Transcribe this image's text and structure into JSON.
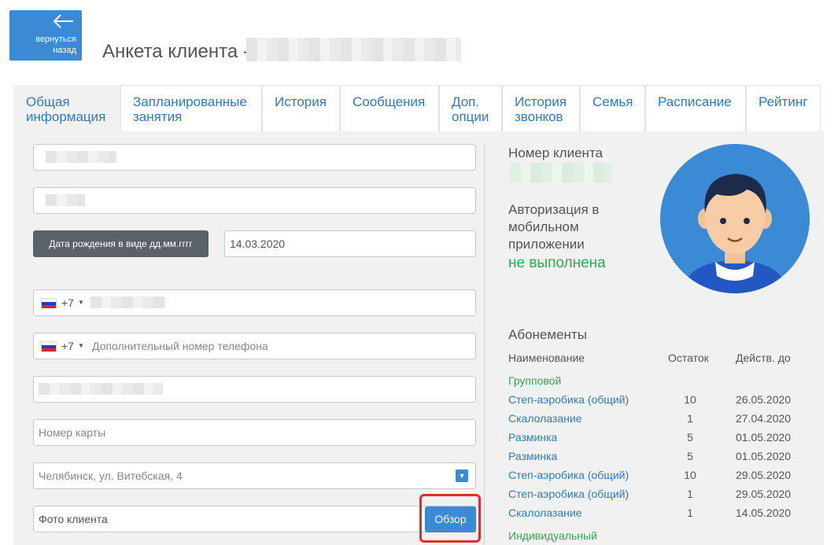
{
  "back_button": {
    "label": "вернуться назад",
    "icon": "arrow-left-icon"
  },
  "page": {
    "title": "Анкета клиента -"
  },
  "tabs": [
    {
      "label": "Общая информация",
      "active": true
    },
    {
      "label": "Запланированные занятия"
    },
    {
      "label": "История"
    },
    {
      "label": "Сообщения"
    },
    {
      "label": "Доп. опции"
    },
    {
      "label": "История звонков"
    },
    {
      "label": "Семья"
    },
    {
      "label": "Расписание"
    },
    {
      "label": "Рейтинг"
    }
  ],
  "form": {
    "dob_label": "Дата рождения в виде дд.мм.гггг",
    "dob_value": "14.03.2020",
    "phone_code": "+7",
    "extra_phone_placeholder": "Дополнительный номер телефона",
    "card_placeholder": "Номер карты",
    "address_value": "Челябинск, ул. Витебская, 4",
    "photo_placeholder": "Фото клиента",
    "browse_label": "Обзор"
  },
  "client": {
    "number_label": "Номер клиента",
    "auth_label": "Авторизация в мобильном приложении",
    "auth_status": "не выполнена",
    "auth_status_color": "#2eab4f"
  },
  "subscriptions": {
    "title": "Абонементы",
    "headers": {
      "name": "Наименование",
      "remain": "Остаток",
      "valid": "Действ. до"
    },
    "group1": "Групповой",
    "rows": [
      {
        "name": "Степ-аэробика (общий)",
        "remain": "10",
        "valid": "26.05.2020"
      },
      {
        "name": "Скалолазание",
        "remain": "1",
        "valid": "27.04.2020"
      },
      {
        "name": "Разминка",
        "remain": "5",
        "valid": "01.05.2020"
      },
      {
        "name": "Разминка",
        "remain": "5",
        "valid": "01.05.2020"
      },
      {
        "name": "Степ-аэробика (общий)",
        "remain": "10",
        "valid": "29.05.2020"
      },
      {
        "name": "Степ-аэробика (общий)",
        "remain": "1",
        "valid": "29.05.2020"
      },
      {
        "name": "Скалолазание",
        "remain": "1",
        "valid": "14.05.2020"
      }
    ],
    "group2": "Индивидуальный"
  },
  "colors": {
    "accent": "#3a8ad6",
    "link": "#2f7bbf",
    "success": "#2eab4f",
    "highlight": "#d9312f"
  }
}
